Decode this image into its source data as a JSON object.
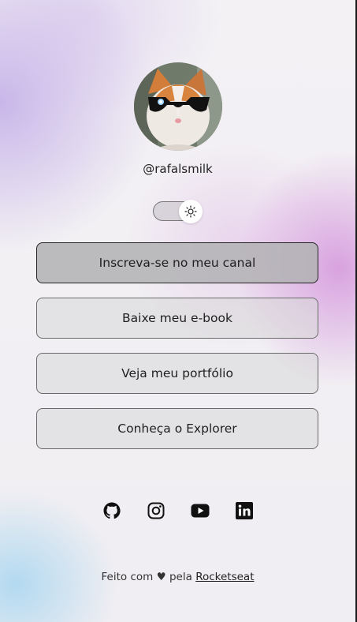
{
  "profile": {
    "username": "@rafalsmilk",
    "avatar_icon": "cat-with-sunglasses-avatar"
  },
  "theme_toggle": {
    "icon": "sun-icon",
    "state": "light"
  },
  "links": [
    {
      "label": "Inscreva-se no meu canal"
    },
    {
      "label": "Baixe meu e-book"
    },
    {
      "label": "Veja meu portfólio"
    },
    {
      "label": "Conheça o Explorer"
    }
  ],
  "socials": [
    {
      "icon": "github-icon"
    },
    {
      "icon": "instagram-icon"
    },
    {
      "icon": "youtube-icon"
    },
    {
      "icon": "linkedin-icon"
    }
  ],
  "footer": {
    "prefix": "Feito com",
    "heart": "♥",
    "middle": "pela",
    "link_text": "Rocketseat"
  }
}
